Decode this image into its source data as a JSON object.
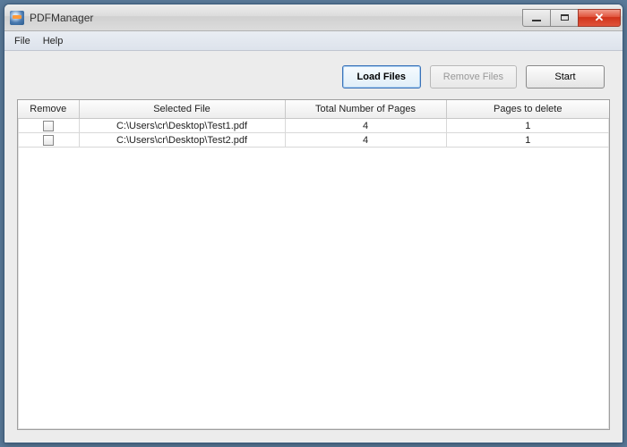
{
  "window": {
    "title": "PDFManager"
  },
  "menu": {
    "file": "File",
    "help": "Help"
  },
  "toolbar": {
    "load": "Load Files",
    "remove": "Remove Files",
    "start": "Start"
  },
  "table": {
    "headers": {
      "remove": "Remove",
      "file": "Selected File",
      "pages": "Total Number of Pages",
      "delete": "Pages to delete"
    },
    "rows": [
      {
        "file": "C:\\Users\\cr\\Desktop\\Test1.pdf",
        "pages": "4",
        "delete": "1"
      },
      {
        "file": "C:\\Users\\cr\\Desktop\\Test2.pdf",
        "pages": "4",
        "delete": "1"
      }
    ]
  }
}
